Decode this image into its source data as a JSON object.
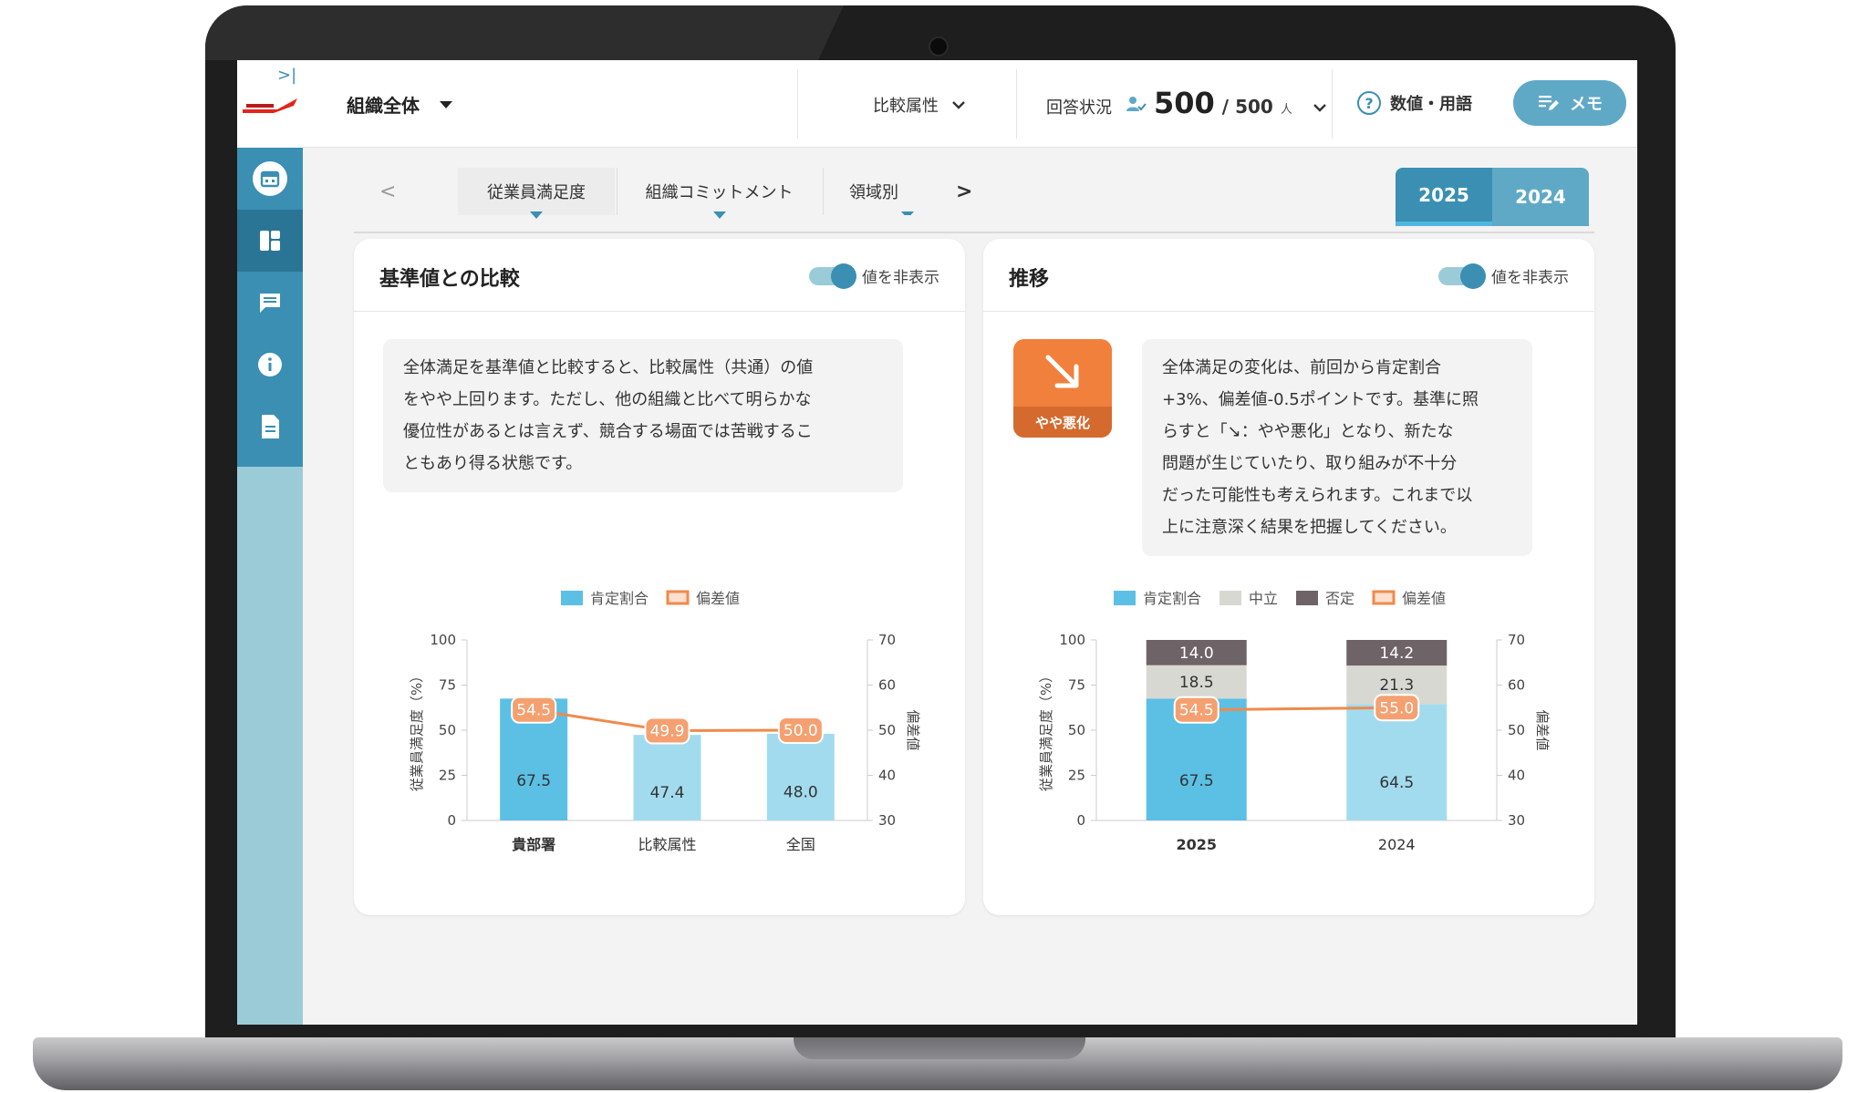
{
  "topbar": {
    "org_selector": "組織全体",
    "compare_selector": "比較属性",
    "response_label": "回答状況",
    "response_count": "500",
    "response_total": "/ 500",
    "response_unit": "人",
    "help_label": "数値・用語",
    "memo_label": "メモ"
  },
  "tabs": [
    {
      "label": "従業員満足度"
    },
    {
      "label": "組織コミットメント"
    },
    {
      "label": "領域別"
    }
  ],
  "years": [
    "2025",
    "2024"
  ],
  "colors": {
    "primary": "#3a8fb3",
    "positive_main": "#5bc0e4",
    "positive_other": "#a3dbee",
    "neutral": "#d8d8d2",
    "negative": "#6e6366",
    "deviation": "#f08a4b",
    "trend_badge": "#f0803c"
  },
  "cards": {
    "benchmark": {
      "title": "基準値との比較",
      "toggle_label": "値を非表示",
      "comment_lines": [
        "全体満足を基準値と比較すると、比較属性（共通）の値",
        "をやや上回ります。ただし、他の組織と比べて明らかな",
        "優位性があるとは言えず、競合する場面では苦戦するこ",
        "ともあり得る状態です。"
      ]
    },
    "trend": {
      "title": "推移",
      "toggle_label": "値を非表示",
      "badge_label": "やや悪化",
      "comment_lines": [
        "全体満足の変化は、前回から肯定割合",
        "+3%、偏差値-0.5ポイントです。基準に照",
        "らすと「↘：やや悪化」となり、新たな",
        "問題が生じていたり、取り組みが不十分",
        "だった可能性も考えられます。これまで以",
        "上に注意深く結果を把握してください。"
      ]
    }
  },
  "chart_data": [
    {
      "type": "bar",
      "categories": [
        "貴部署",
        "比較属性",
        "全国"
      ],
      "highlight_category": "貴部署",
      "series": [
        {
          "name": "肯定割合",
          "values": [
            67.5,
            47.4,
            48.0
          ]
        },
        {
          "name": "偏差値",
          "values": [
            54.5,
            49.9,
            50.0
          ],
          "render": "line",
          "axis": "right"
        }
      ],
      "ylabel": "従業員満足度（%）",
      "y2label": "偏差値",
      "ylim": [
        0,
        100
      ],
      "y2lim": [
        30,
        70
      ],
      "yticks": [
        0,
        25,
        50,
        75,
        100
      ],
      "y2ticks": [
        30,
        40,
        50,
        60,
        70
      ],
      "legend": "top"
    },
    {
      "type": "bar",
      "stacked": true,
      "categories": [
        "2025",
        "2024"
      ],
      "highlight_category": "2025",
      "series": [
        {
          "name": "肯定割合",
          "values": [
            67.5,
            64.5
          ]
        },
        {
          "name": "中立",
          "values": [
            18.5,
            21.3
          ]
        },
        {
          "name": "否定",
          "values": [
            14.0,
            14.2
          ]
        },
        {
          "name": "偏差値",
          "values": [
            54.5,
            55.0
          ],
          "render": "line",
          "axis": "right"
        }
      ],
      "ylabel": "従業員満足度（%）",
      "y2label": "偏差値",
      "ylim": [
        0,
        100
      ],
      "y2lim": [
        30,
        70
      ],
      "yticks": [
        0,
        25,
        50,
        75,
        100
      ],
      "y2ticks": [
        30,
        40,
        50,
        60,
        70
      ],
      "legend": "top"
    }
  ]
}
